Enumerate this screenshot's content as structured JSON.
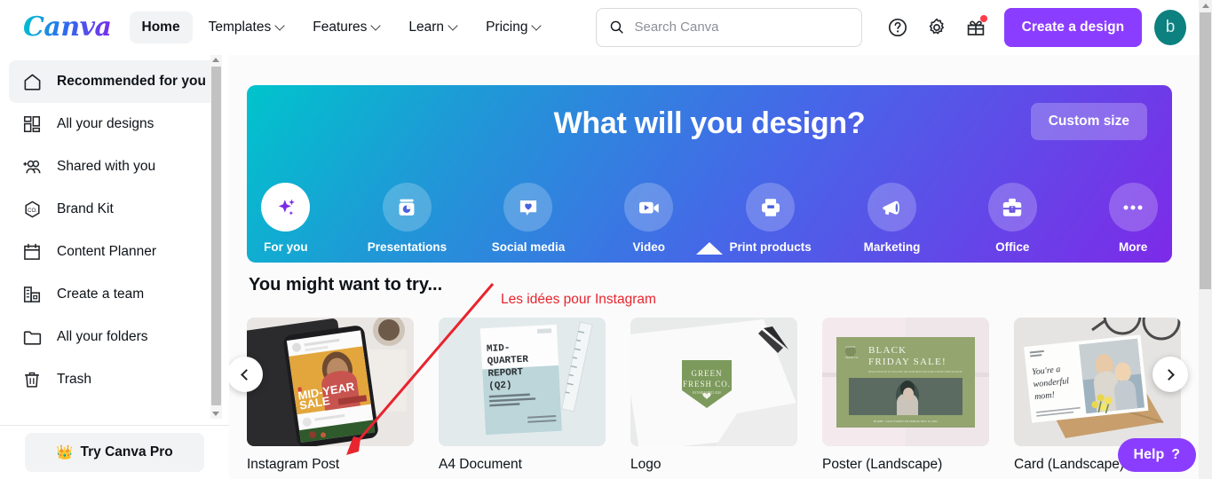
{
  "header": {
    "logo": "Canva",
    "nav": [
      {
        "label": "Home",
        "active": true,
        "caret": false
      },
      {
        "label": "Templates",
        "active": false,
        "caret": true
      },
      {
        "label": "Features",
        "active": false,
        "caret": true
      },
      {
        "label": "Learn",
        "active": false,
        "caret": true
      },
      {
        "label": "Pricing",
        "active": false,
        "caret": true
      }
    ],
    "search_placeholder": "Search Canva",
    "search_value": "",
    "icons": [
      "help-circle-icon",
      "gear-icon",
      "gift-icon"
    ],
    "notification_dot_color": "#ff3b47",
    "cta_label": "Create a design",
    "cta_color": "#8b3dff",
    "avatar_initial": "b",
    "avatar_color": "#0d8080"
  },
  "sidebar": {
    "items": [
      {
        "label": "Recommended for you",
        "icon": "home-icon",
        "active": true
      },
      {
        "label": "All your designs",
        "icon": "grid-icon",
        "active": false
      },
      {
        "label": "Shared with you",
        "icon": "people-add-icon",
        "active": false
      },
      {
        "label": "Brand Kit",
        "icon": "brand-hexagon-icon",
        "active": false
      },
      {
        "label": "Content Planner",
        "icon": "calendar-icon",
        "active": false
      },
      {
        "label": "Create a team",
        "icon": "building-icon",
        "active": false
      },
      {
        "label": "All your folders",
        "icon": "folder-icon",
        "active": false
      },
      {
        "label": "Trash",
        "icon": "trash-icon",
        "active": false
      }
    ],
    "pro_button": "Try Canva Pro",
    "pro_icon": "crown-icon"
  },
  "banner": {
    "title": "What will you design?",
    "custom_size_label": "Custom size",
    "gradient_from": "#00c4cc",
    "gradient_to": "#7d2ae8",
    "categories": [
      {
        "label": "For you",
        "icon": "sparkle-icon",
        "active": true
      },
      {
        "label": "Presentations",
        "icon": "presentation-jar-icon",
        "active": false
      },
      {
        "label": "Social media",
        "icon": "heart-bubble-icon",
        "active": false
      },
      {
        "label": "Video",
        "icon": "video-camera-icon",
        "active": false
      },
      {
        "label": "Print products",
        "icon": "printer-icon",
        "active": false
      },
      {
        "label": "Marketing",
        "icon": "megaphone-icon",
        "active": false
      },
      {
        "label": "Office",
        "icon": "briefcase-icon",
        "active": false
      },
      {
        "label": "More",
        "icon": "ellipsis-icon",
        "active": false
      }
    ]
  },
  "main": {
    "section_title": "You might want to try...",
    "cards": [
      {
        "label": "Instagram Post",
        "thumb": "phone-mid-year-sale",
        "thumb_text": "MID-YEAR SALE"
      },
      {
        "label": "A4 Document",
        "thumb": "mid-quarter-report",
        "thumb_text": "MID- QUARTER REPORT (Q2)"
      },
      {
        "label": "Logo",
        "thumb": "green-fresh-co-logo",
        "thumb_text": "GREEN FRESH CO."
      },
      {
        "label": "Poster (Landscape)",
        "thumb": "black-friday-poster",
        "thumb_text": "BLACK FRIDAY SALE!"
      },
      {
        "label": "Card (Landscape)",
        "thumb": "wonderful-mom-card",
        "thumb_text": "You're a wonderful mom!"
      }
    ],
    "prev_arrow": "chevron-left-icon",
    "next_arrow": "chevron-right-icon"
  },
  "annotation": {
    "text": "Les idées pour Instagram",
    "color": "#e8242e"
  },
  "help": {
    "label": "Help",
    "mark": "?",
    "color": "#8b3dff"
  }
}
